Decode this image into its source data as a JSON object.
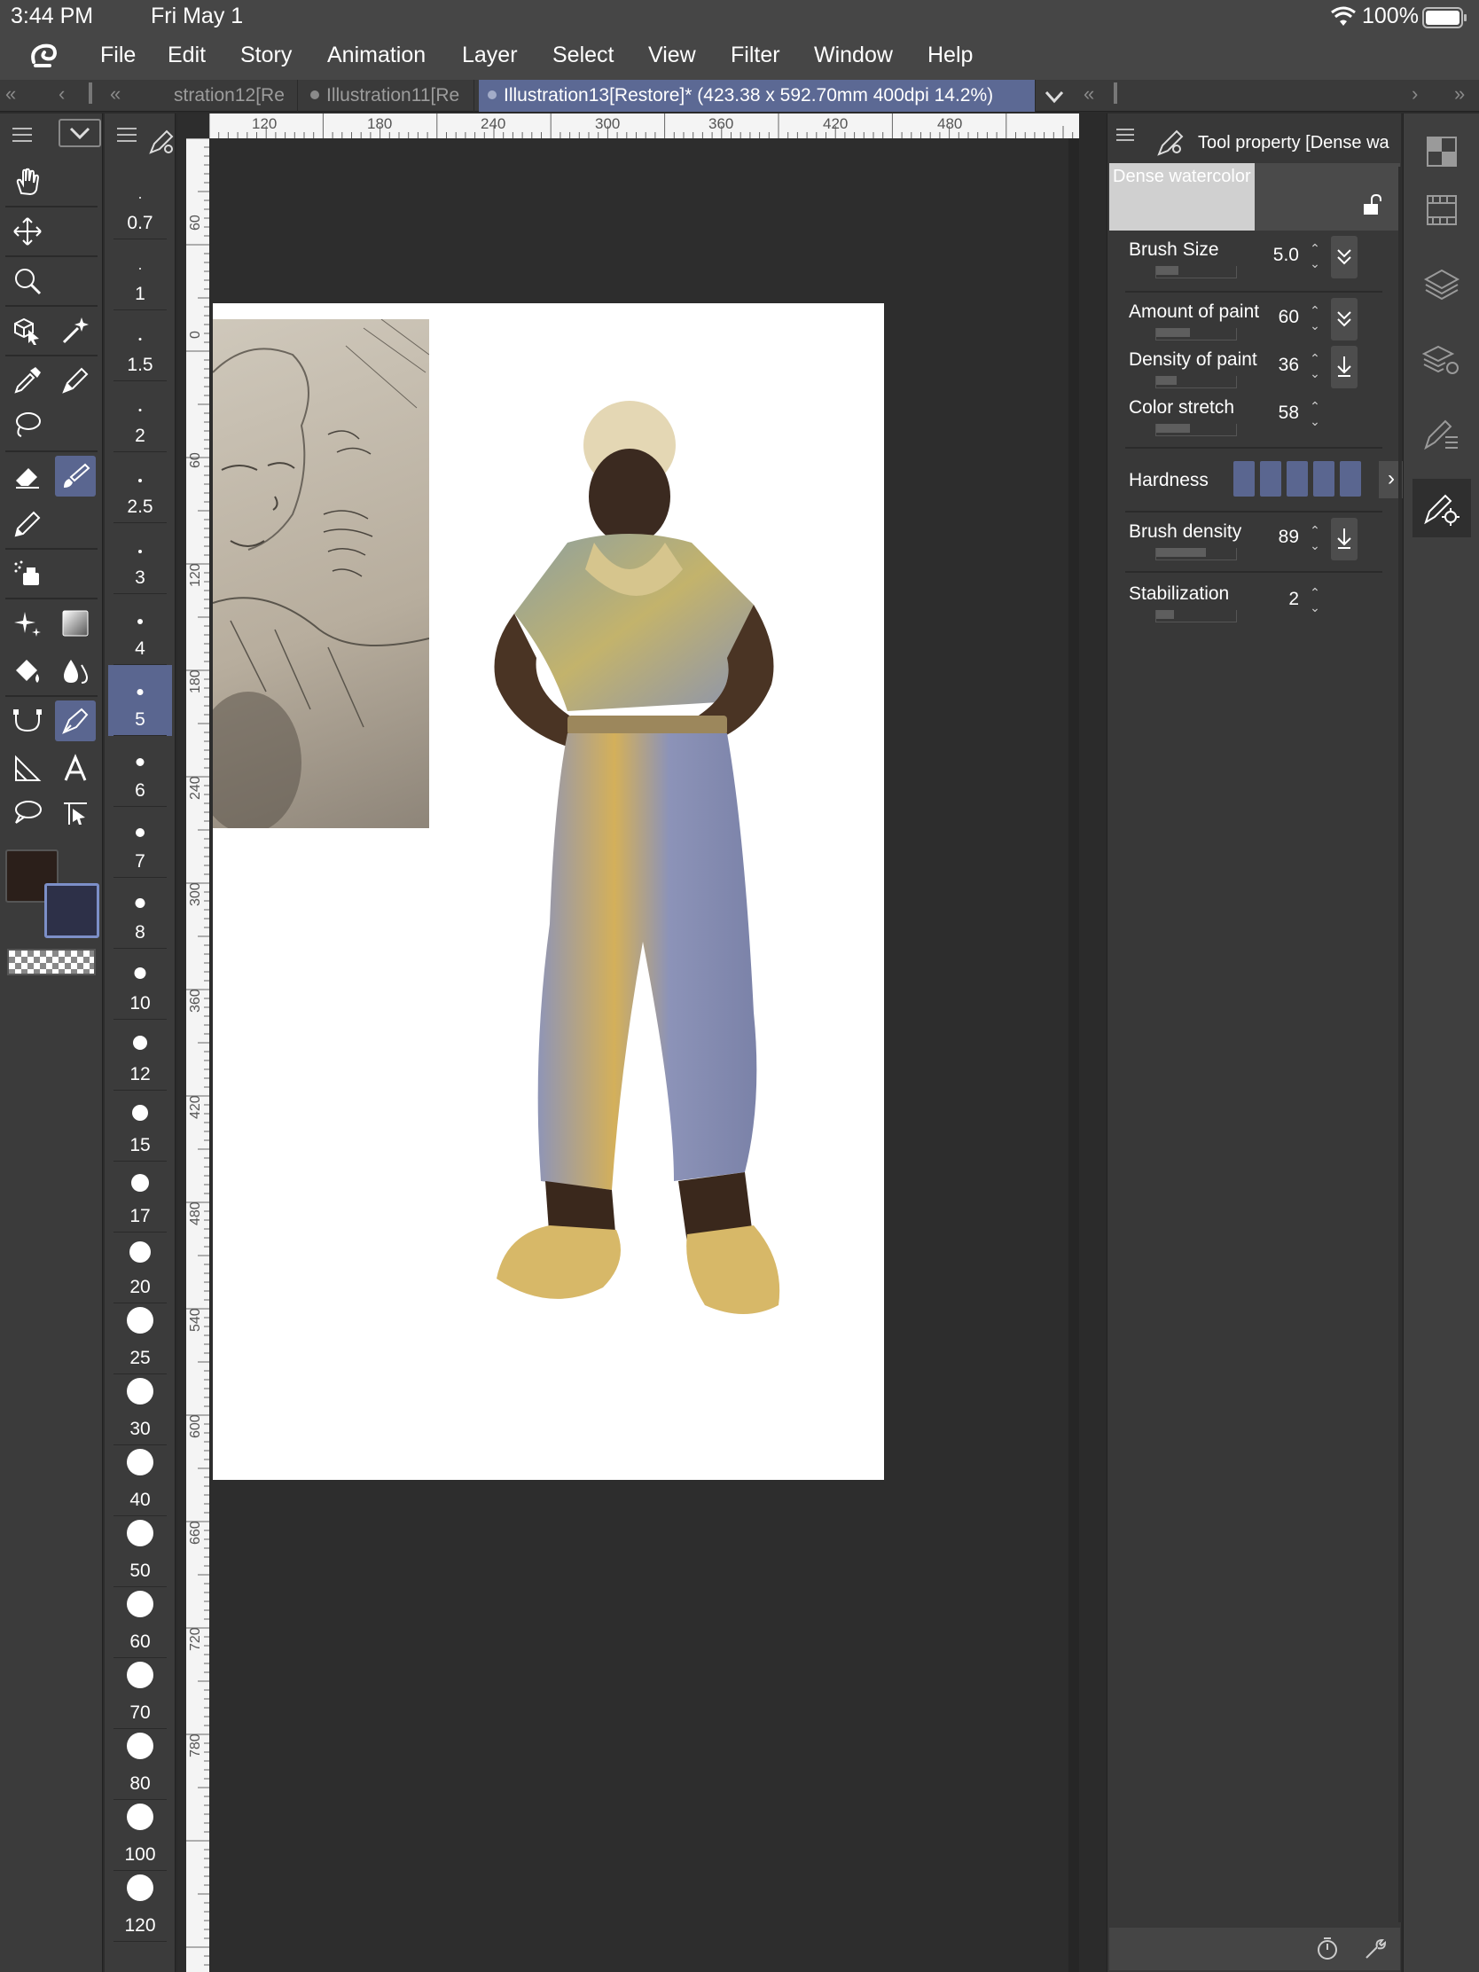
{
  "status": {
    "time": "3:44 PM",
    "date": "Fri May 1",
    "battery": "100%",
    "icons": [
      "wifi-icon",
      "battery-icon"
    ]
  },
  "menu": {
    "logo_icon": "clip-studio-logo-icon",
    "items": [
      "File",
      "Edit",
      "Story",
      "Animation",
      "Layer",
      "Select",
      "View",
      "Filter",
      "Window",
      "Help"
    ]
  },
  "tabs": {
    "items": [
      {
        "label": "stration12[Re",
        "active": false
      },
      {
        "label": "Illustration11[Re",
        "active": false
      },
      {
        "label": "Illustration13[Restore]* (423.38 x 592.70mm 400dpi 14.2%)",
        "active": true
      }
    ],
    "nav_left": "«",
    "nav_prev": "‹",
    "nav_right": "›",
    "nav_far_right": "»"
  },
  "tools": {
    "icons": [
      "hand-icon",
      "move-icon",
      "zoom-icon",
      "object-select-icon",
      "magic-wand-icon",
      "eyedropper-icon",
      "pen-icon",
      "lasso-icon",
      "eraser-icon",
      "brush-icon",
      "pencil-icon",
      "airbrush-icon",
      "sparkle-icon",
      "gradient-icon",
      "fill-icon",
      "blend-icon",
      "ruler-icon",
      "vector-pen-icon",
      "frame-icon",
      "text-icon",
      "balloon-icon",
      "line-correct-icon"
    ],
    "main_color": "#2b1f1a",
    "sub_color": "#2d3048"
  },
  "brush_sizes": {
    "values": [
      "0.7",
      "1",
      "1.5",
      "2",
      "2.5",
      "3",
      "4",
      "5",
      "6",
      "7",
      "8",
      "10",
      "12",
      "15",
      "17",
      "20",
      "25",
      "30",
      "40",
      "50",
      "60",
      "70",
      "80",
      "100",
      "120"
    ],
    "selected": "5"
  },
  "rulers": {
    "top": [
      "120",
      "180",
      "240",
      "300",
      "360",
      "420",
      "480"
    ],
    "left": [
      "60",
      "0",
      "60",
      "120",
      "180",
      "240",
      "300",
      "360",
      "420",
      "480",
      "540",
      "600",
      "660",
      "720",
      "780"
    ]
  },
  "tool_property": {
    "title": "Tool property [Dense wa",
    "brush_name": "Dense watercolor",
    "properties": [
      {
        "label": "Brush Size",
        "value": "5.0",
        "fill": 0.28,
        "button": "check-double-icon"
      },
      {
        "label": "Amount of paint",
        "value": "60",
        "fill": 0.42,
        "button": "check-double-icon"
      },
      {
        "label": "Density of paint",
        "value": "36",
        "fill": 0.26,
        "button": "download-icon"
      },
      {
        "label": "Color stretch",
        "value": "58",
        "fill": 0.42,
        "button": ""
      }
    ],
    "hardness": {
      "label": "Hardness",
      "level": 5
    },
    "brush_density": {
      "label": "Brush density",
      "value": "89",
      "fill": 0.62,
      "button": "download-icon"
    },
    "stabilization": {
      "label": "Stabilization",
      "value": "2",
      "fill": 0.22
    }
  },
  "right_strip": {
    "icons": [
      "color-set-icon",
      "animation-icon",
      "layer-icon",
      "layer-property-icon",
      "sub-tool-icon",
      "tool-property-icon"
    ]
  }
}
